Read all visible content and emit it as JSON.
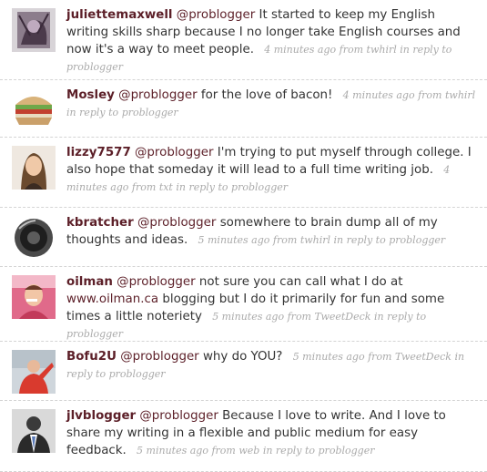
{
  "colors": {
    "link": "#5c1f28",
    "text": "#333333",
    "meta": "#aaaaaa"
  },
  "tweets": [
    {
      "user": "juliettemaxwell",
      "mention": "@problogger",
      "text": "It started to keep my English writing skills sharp because I no longer take English courses and now it's a way to meet people.",
      "time": "4 minutes ago",
      "from_label": "from",
      "source": "twhirl",
      "reply_label": "in reply to",
      "reply_to": "problogger",
      "avatar_icon": "user-avatar-icon"
    },
    {
      "user": "Mosley",
      "mention": "@problogger",
      "text": "for the love of bacon!",
      "time": "4 minutes ago",
      "from_label": "from",
      "source": "twhirl",
      "reply_label": "in reply to",
      "reply_to": "problogger",
      "avatar_icon": "sandwich-icon"
    },
    {
      "user": "lizzy7577",
      "mention": "@problogger",
      "text": "I'm trying to put myself through college. I also hope that someday it will lead to a full time writing job.",
      "time": "4 minutes ago",
      "from_label": "from",
      "source": "txt",
      "reply_label": "in reply to",
      "reply_to": "problogger",
      "avatar_icon": "user-avatar-icon"
    },
    {
      "user": "kbratcher",
      "mention": "@problogger",
      "text": "somewhere to brain dump all of my thoughts and ideas.",
      "time": "5 minutes ago",
      "from_label": "from",
      "source": "twhirl",
      "reply_label": "in reply to",
      "reply_to": "problogger",
      "avatar_icon": "speaker-icon"
    },
    {
      "user": "oilman",
      "mention": "@problogger",
      "text_before": "not sure you can call what I do at",
      "link": "www.oilman.ca",
      "text_after": "blogging but I do it primarily for fun and some times a little noteriety",
      "time": "5 minutes ago",
      "from_label": "from",
      "source": "TweetDeck",
      "reply_label": "in reply to",
      "reply_to": "problogger",
      "avatar_icon": "user-avatar-icon"
    },
    {
      "user": "Bofu2U",
      "mention": "@problogger",
      "text": "why do YOU?",
      "time": "5 minutes ago",
      "from_label": "from",
      "source": "TweetDeck",
      "reply_label": "in reply to",
      "reply_to": "problogger",
      "avatar_icon": "user-avatar-icon"
    },
    {
      "user": "jlvblogger",
      "mention": "@problogger",
      "text": "Because I love to write. And I love to share my writing in a flexible and public medium for easy feedback.",
      "time": "5 minutes ago",
      "from_label": "from",
      "source": "web",
      "reply_label": "in reply to",
      "reply_to": "problogger",
      "avatar_icon": "user-avatar-icon"
    }
  ]
}
